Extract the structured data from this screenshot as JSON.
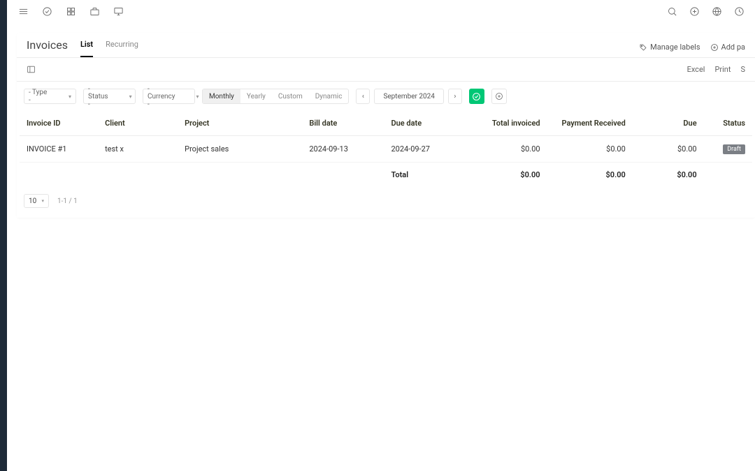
{
  "page": {
    "title": "Invoices",
    "tabs": [
      {
        "label": "List",
        "active": true
      },
      {
        "label": "Recurring",
        "active": false
      }
    ],
    "actions": {
      "manage_labels": "Manage labels",
      "add_payment": "Add pa"
    }
  },
  "subbar": {
    "export_excel": "Excel",
    "print": "Print",
    "extra": "S"
  },
  "filters": {
    "type": "- Type -",
    "status": "- Status -",
    "currency": "- Currency -",
    "period_modes": [
      {
        "label": "Monthly",
        "active": true
      },
      {
        "label": "Yearly",
        "active": false
      },
      {
        "label": "Custom",
        "active": false
      },
      {
        "label": "Dynamic",
        "active": false
      }
    ],
    "date_label": "September 2024"
  },
  "table": {
    "headers": {
      "invoice_id": "Invoice ID",
      "client": "Client",
      "project": "Project",
      "bill_date": "Bill date",
      "due_date": "Due date",
      "total_invoiced": "Total invoiced",
      "payment_received": "Payment Received",
      "due": "Due",
      "status": "Status"
    },
    "rows": [
      {
        "invoice_id": "INVOICE #1",
        "client": "test x",
        "project": "Project sales",
        "bill_date": "2024-09-13",
        "due_date": "2024-09-27",
        "total_invoiced": "$0.00",
        "payment_received": "$0.00",
        "due": "$0.00",
        "status": "Draft"
      }
    ],
    "totals": {
      "label": "Total",
      "total_invoiced": "$0.00",
      "payment_received": "$0.00",
      "due": "$0.00"
    }
  },
  "pager": {
    "size": "10",
    "info": "1-1 / 1"
  }
}
